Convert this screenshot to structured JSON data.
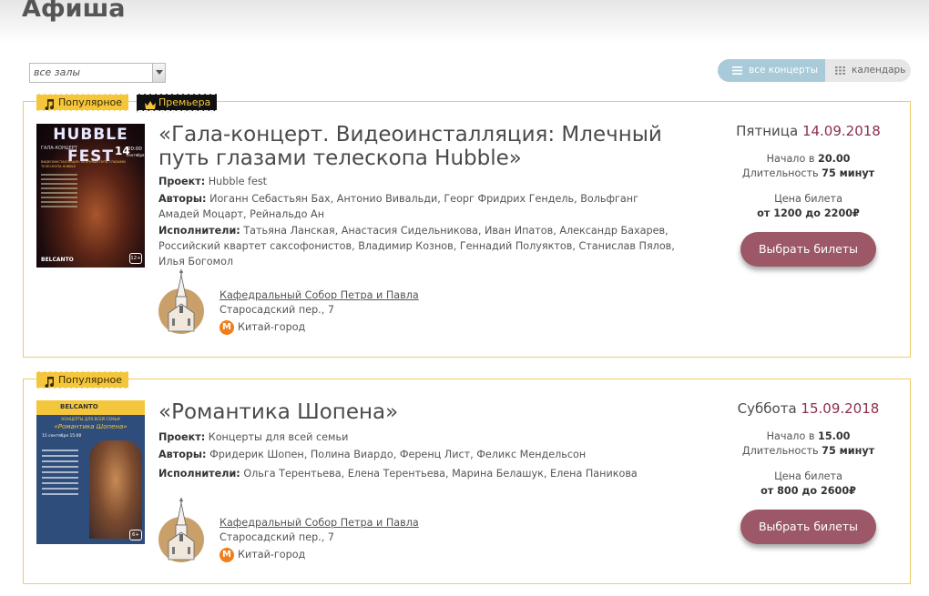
{
  "page": {
    "title": "Афиша"
  },
  "filters": {
    "hall_select": {
      "value": "все залы"
    },
    "view_all": {
      "label": "все концерты",
      "icon": "list-icon"
    },
    "view_calendar": {
      "label": "календарь",
      "icon": "calendar-grid-icon"
    }
  },
  "colors": {
    "accent_gold": "#f4c63c",
    "date_accent": "#8e2e4a",
    "buy_button": "#9c5866",
    "card_border": "#f1cc63",
    "metro_orange": "#f27d1b"
  },
  "events": [
    {
      "badges": [
        {
          "label": "Популярное",
          "icon": "music-note-icon"
        },
        {
          "label": "Премьера",
          "icon": "crown-icon"
        }
      ],
      "poster": {
        "headline": "HUBBLE FEST",
        "sub": "ГАЛА-КОНЦЕРТ",
        "day": "14",
        "time": "20:00",
        "month": "сентября",
        "desc": "ВИДЕОИНСТАЛЛЯЦИЯ: МЛЕЧНЫЙ ПУТЬ ГЛАЗАМИ ТЕЛЕСКОПА HUBBLE",
        "brand": "BELCANTO",
        "age": "12+"
      },
      "title": "«Гала-концерт. Видеоинсталляция: Млечный путь глазами телескопа Hubble»",
      "project_label": "Проект:",
      "project": "Hubble fest",
      "authors_label": "Авторы:",
      "authors": "Иоганн Себастьян Бах, Антонио Вивальди, Георг Фридрих Гендель, Вольфганг Амадей Моцарт, Рейнальдо Ан",
      "performers_label": "Исполнители:",
      "performers": "Татьяна Ланская, Анастасия Сидельникова, Иван Ипатов, Александр Бахарев, Российский квартет саксофонистов, Владимир Кознов, Геннадий Полуяктов, Станислав Пялов, Илья Богомол",
      "venue": {
        "name": "Кафедральный Собор Петра и Павла",
        "address": "Старосадский пер., 7",
        "metro_letter": "M",
        "metro": "Китай-город"
      },
      "weekday": "Пятница",
      "date": "14.09.2018",
      "start_label": "Начало в",
      "start": "20.00",
      "duration_label": "Длительность",
      "duration": "75 минут",
      "price_label": "Цена билета",
      "price": "от 1200 до 2200₽",
      "buy_label": "Выбрать билеты"
    },
    {
      "badges": [
        {
          "label": "Популярное",
          "icon": "music-note-icon"
        }
      ],
      "poster": {
        "brand": "BELCANTO",
        "sub": "КОНЦЕРТЫ ДЛЯ ВСЕЙ СЕМЬИ",
        "headline": "«Романтика Шопена»",
        "date_line": "15 сентября 15:00",
        "age": "6+"
      },
      "title": "«Романтика Шопена»",
      "project_label": "Проект:",
      "project": "Концерты для всей семьи",
      "authors_label": "Авторы:",
      "authors": "Фридерик Шопен, Полина Виардо, Ференц Лист, Феликс Мендельсон",
      "performers_label": "Исполнители:",
      "performers": "Ольга Терентьева, Елена Терентьева, Марина Белашук, Елена Паникова",
      "venue": {
        "name": "Кафедральный Собор Петра и Павла",
        "address": "Старосадский пер., 7",
        "metro_letter": "M",
        "metro": "Китай-город"
      },
      "weekday": "Суббота",
      "date": "15.09.2018",
      "start_label": "Начало в",
      "start": "15.00",
      "duration_label": "Длительность",
      "duration": "75 минут",
      "price_label": "Цена билета",
      "price": "от 800 до 2600₽",
      "buy_label": "Выбрать билеты"
    }
  ]
}
